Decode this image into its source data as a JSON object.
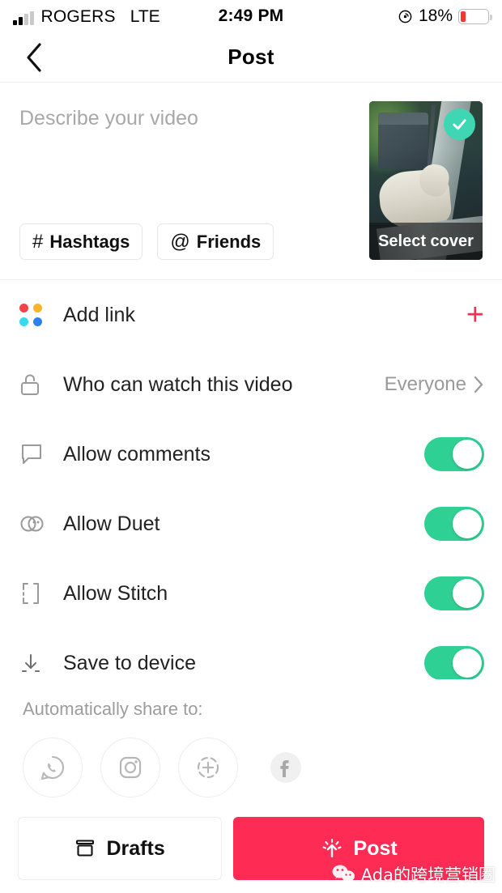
{
  "status_bar": {
    "carrier": "ROGERS",
    "network": "LTE",
    "time": "2:49 PM",
    "battery_percent": "18%",
    "signal_bars_filled": 2,
    "signal_bars_total": 4,
    "battery_level": 18,
    "battery_color": "#f6352f"
  },
  "nav": {
    "title": "Post",
    "back_icon": "chevron-left-icon"
  },
  "describe": {
    "placeholder": "Describe your video",
    "value": "",
    "hashtags_label": "Hashtags",
    "hashtags_glyph": "#",
    "friends_label": "Friends",
    "friends_glyph": "@"
  },
  "cover": {
    "select_cover_label": "Select cover",
    "badge_icon": "check-circle-icon",
    "badge_color": "#3fd6b4"
  },
  "settings": [
    {
      "id": "add-link",
      "label": "Add link",
      "icon": "four-dots-icon",
      "control": "plus",
      "plus_label": "+",
      "accent": "#fe2c55",
      "dot_colors": [
        "#f0434a",
        "#f7b529",
        "#38d9f0",
        "#2f80ed"
      ]
    },
    {
      "id": "who-can-watch",
      "label": "Who can watch this video",
      "icon": "unlock-icon",
      "control": "value",
      "value": "Everyone",
      "chevron": "chevron-right-icon"
    },
    {
      "id": "allow-comments",
      "label": "Allow comments",
      "icon": "comment-bubble-icon",
      "control": "toggle",
      "toggle_on": true
    },
    {
      "id": "allow-duet",
      "label": "Allow Duet",
      "icon": "duet-icon",
      "control": "toggle",
      "toggle_on": true
    },
    {
      "id": "allow-stitch",
      "label": "Allow Stitch",
      "icon": "stitch-brackets-icon",
      "control": "toggle",
      "toggle_on": true
    },
    {
      "id": "save-to-device",
      "label": "Save to device",
      "icon": "download-icon",
      "control": "toggle",
      "toggle_on": true
    }
  ],
  "share": {
    "title": "Automatically share to:",
    "targets": [
      {
        "id": "whatsapp",
        "icon": "whatsapp-icon"
      },
      {
        "id": "instagram",
        "icon": "instagram-icon"
      },
      {
        "id": "instagram-story",
        "icon": "instagram-story-icon"
      },
      {
        "id": "facebook",
        "icon": "facebook-icon"
      }
    ]
  },
  "actions": {
    "drafts_label": "Drafts",
    "drafts_icon": "drafts-archive-icon",
    "post_label": "Post",
    "post_icon": "upload-arrow-icon",
    "post_color": "#fe2c55"
  },
  "watermark": {
    "text": "Ada的跨境营销圈",
    "icon": "wechat-icon"
  },
  "toggle_color": "#2fd093"
}
